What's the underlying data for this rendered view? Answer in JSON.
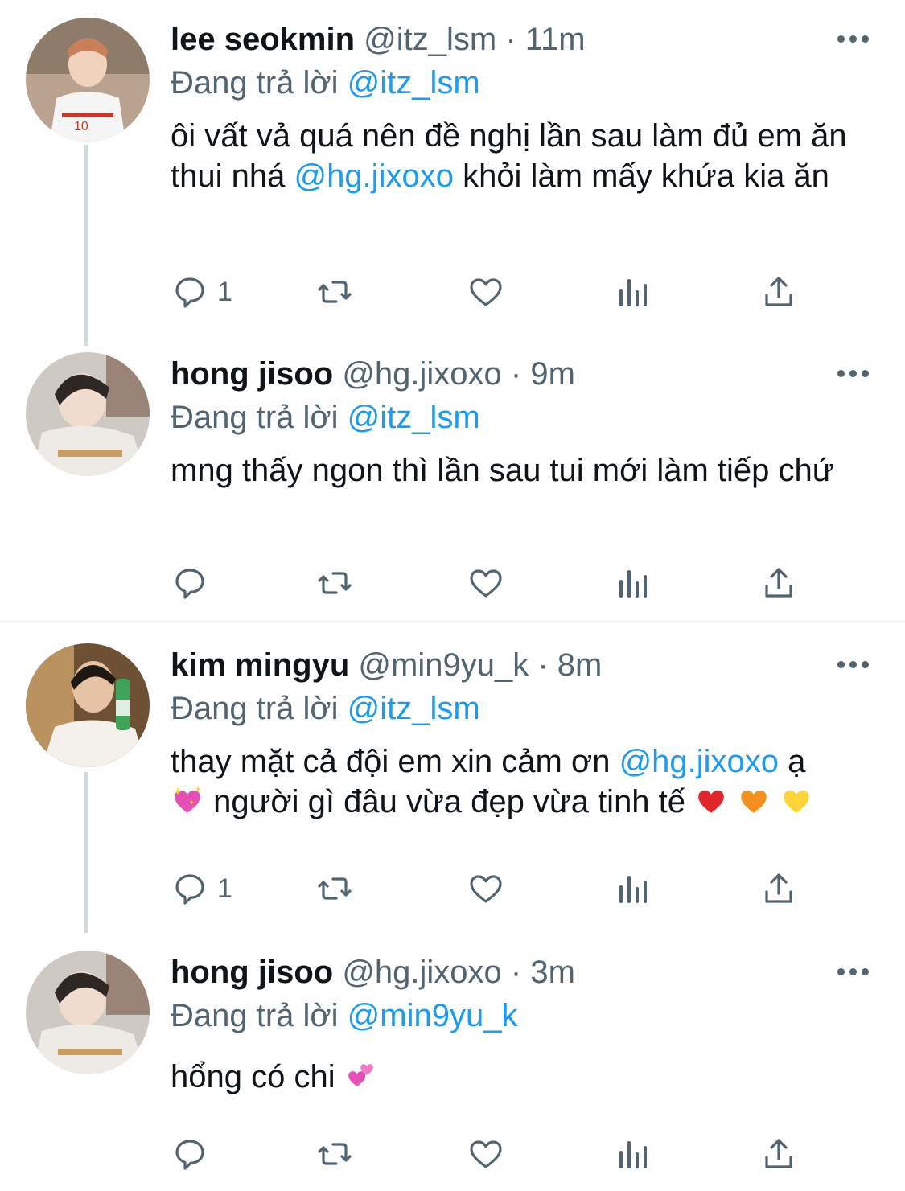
{
  "tweets": [
    {
      "name": "lee seokmin",
      "handle": "@itz_lsm",
      "dot": "·",
      "time": "11m",
      "replying_prefix": "Đang trả lời",
      "replying_to": "@itz_lsm",
      "text_parts": [
        "ôi vất vả quá nên đề nghị lần sau làm đủ em ăn thui nhá ",
        "@hg.jixoxo",
        " khỏi làm mấy khứa kia ăn"
      ],
      "reply_count": "1",
      "avatar_colors": [
        "#b08a73",
        "#e9e4dc"
      ]
    },
    {
      "name": "hong jisoo",
      "handle": "@hg.jixoxo",
      "dot": "·",
      "time": "9m",
      "replying_prefix": "Đang trả lời",
      "replying_to": "@itz_lsm",
      "text": "mng thấy ngon thì lần sau tui mới làm tiếp chứ",
      "reply_count": "",
      "avatar_colors": [
        "#6b5a52",
        "#d9d4cf"
      ]
    },
    {
      "name": "kim mingyu",
      "handle": "@min9yu_k",
      "dot": "·",
      "time": "8m",
      "replying_prefix": "Đang trả lời",
      "replying_to": "@itz_lsm",
      "text_parts": [
        "thay mặt cả đội em xin cảm ơn ",
        "@hg.jixoxo",
        " ạ",
        " người gì đâu vừa đẹp vừa tinh tế "
      ],
      "reply_count": "1",
      "avatar_colors": [
        "#8c6b4a",
        "#efe3d2"
      ]
    },
    {
      "name": "hong jisoo",
      "handle": "@hg.jixoxo",
      "dot": "·",
      "time": "3m",
      "replying_prefix": "Đang trả lời",
      "replying_to": "@min9yu_k",
      "text": "hổng có chi ",
      "reply_count": "",
      "avatar_colors": [
        "#6b5a52",
        "#d9d4cf"
      ]
    }
  ],
  "colors": {
    "text": "#0f1419",
    "secondary": "#536471",
    "link": "#1d9bf0",
    "thread_line": "#cfd9de",
    "divider": "#eff3f4"
  },
  "icons": [
    "reply-icon",
    "retweet-icon",
    "like-icon",
    "analytics-icon",
    "share-icon",
    "more-icon",
    "sparkling-heart-emoji",
    "red-heart-emoji",
    "orange-heart-emoji",
    "yellow-heart-emoji",
    "two-hearts-emoji"
  ]
}
